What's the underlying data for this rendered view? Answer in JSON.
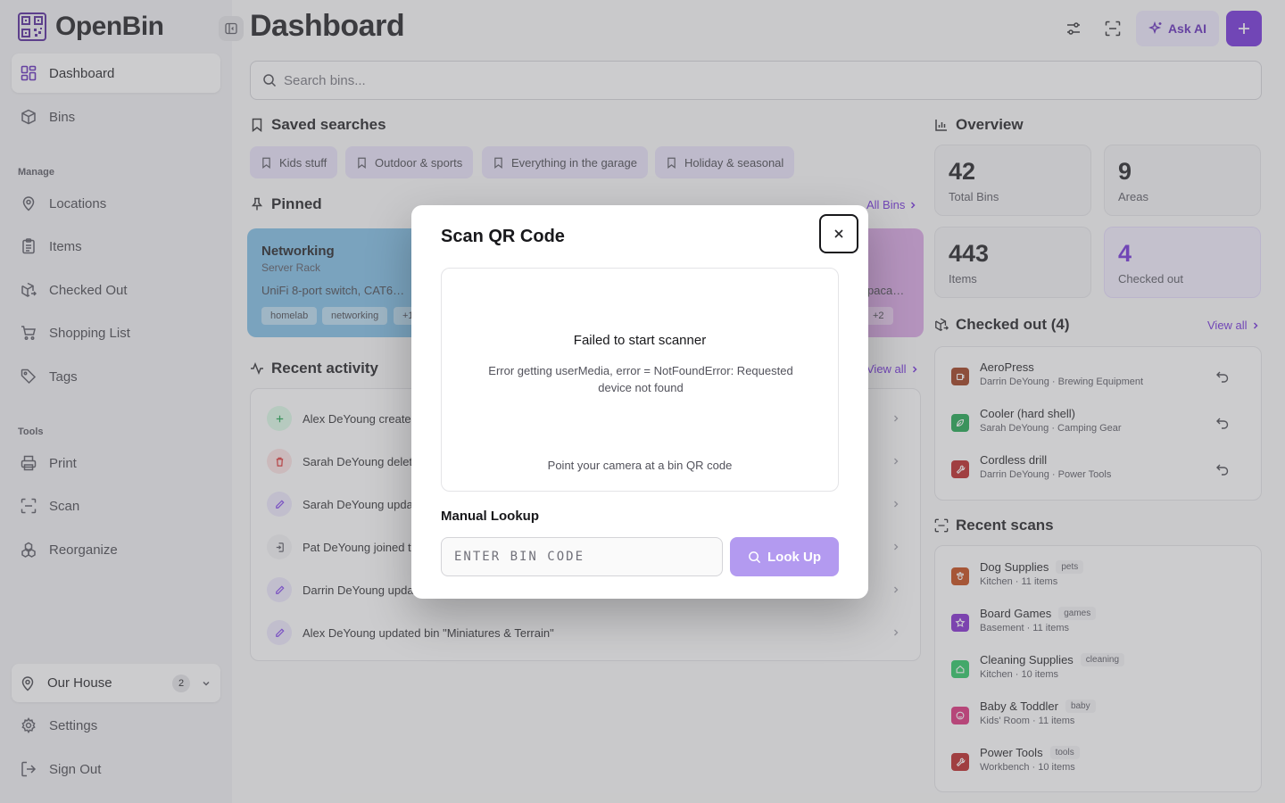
{
  "app": {
    "name": "OpenBin"
  },
  "sidebar": {
    "nav": [
      {
        "label": "Dashboard",
        "icon": "dashboard-icon",
        "active": true
      },
      {
        "label": "Bins",
        "icon": "box-icon"
      }
    ],
    "manage_heading": "Manage",
    "manage": [
      {
        "label": "Locations",
        "icon": "map-pin-icon"
      },
      {
        "label": "Items",
        "icon": "clipboard-list-icon"
      },
      {
        "label": "Checked Out",
        "icon": "package-out-icon"
      },
      {
        "label": "Shopping List",
        "icon": "shopping-cart-icon"
      },
      {
        "label": "Tags",
        "icon": "tag-icon"
      }
    ],
    "tools_heading": "Tools",
    "tools": [
      {
        "label": "Print",
        "icon": "printer-icon"
      },
      {
        "label": "Scan",
        "icon": "scan-icon"
      },
      {
        "label": "Reorganize",
        "icon": "reorganize-icon"
      }
    ],
    "location": {
      "label": "Our House",
      "count": "2"
    },
    "settings_label": "Settings",
    "signout_label": "Sign Out"
  },
  "header": {
    "title": "Dashboard",
    "ask_ai_label": "Ask AI"
  },
  "search": {
    "placeholder": "Search bins..."
  },
  "saved_searches": {
    "title": "Saved searches",
    "chips": [
      "Kids stuff",
      "Outdoor & sports",
      "Everything in the garage",
      "Holiday & seasonal"
    ]
  },
  "pinned": {
    "title": "Pinned",
    "all_bins_label": "All Bins",
    "cards": [
      {
        "name": "Networking",
        "area": "Server Rack",
        "desc": "UniFi 8-port switch, CAT6…",
        "tags": [
          "homelab",
          "networking",
          "+1"
        ],
        "color": "#3b9fd8"
      },
      {
        "name": "",
        "area": "",
        "desc": "paca…",
        "tags": [
          "+2"
        ],
        "color": "#c26ad8"
      }
    ]
  },
  "recent_activity": {
    "title": "Recent activity",
    "view_all_label": "View all",
    "rows": [
      {
        "text": "Alex DeYoung create",
        "kind": "create",
        "color": "#16a34a",
        "bg": "#dcfce7"
      },
      {
        "text": "Sarah DeYoung delet",
        "kind": "delete",
        "color": "#dc2626",
        "bg": "#fee2e2"
      },
      {
        "text": "Sarah DeYoung upda",
        "kind": "update",
        "color": "#7c3aed",
        "bg": "#ede9fe"
      },
      {
        "text": "Pat DeYoung joined t",
        "kind": "join",
        "color": "#52525b",
        "bg": "#f4f4f5"
      },
      {
        "text": "Darrin DeYoung upda",
        "kind": "update",
        "color": "#7c3aed",
        "bg": "#ede9fe"
      },
      {
        "text": "Alex DeYoung updated bin \"Miniatures & Terrain\"",
        "kind": "update",
        "color": "#7c3aed",
        "bg": "#ede9fe"
      }
    ]
  },
  "overview": {
    "title": "Overview",
    "stats": [
      {
        "value": "42",
        "label": "Total Bins"
      },
      {
        "value": "9",
        "label": "Areas"
      },
      {
        "value": "443",
        "label": "Items"
      },
      {
        "value": "4",
        "label": "Checked out",
        "accent": "#6d28d9"
      }
    ]
  },
  "checked_out": {
    "title": "Checked out (4)",
    "view_all_label": "View all",
    "rows": [
      {
        "name": "AeroPress",
        "meta": "Darrin DeYoung · Brewing Equipment",
        "color": "#9a3412",
        "icon": "coffee-icon"
      },
      {
        "name": "Cooler (hard shell)",
        "meta": "Sarah DeYoung · Camping Gear",
        "color": "#16a34a",
        "icon": "leaf-icon"
      },
      {
        "name": "Cordless drill",
        "meta": "Darrin DeYoung · Power Tools",
        "color": "#b91c1c",
        "icon": "wrench-icon"
      }
    ]
  },
  "recent_scans": {
    "title": "Recent scans",
    "rows": [
      {
        "name": "Dog Supplies",
        "tag": "pets",
        "meta": "Kitchen · 11 items",
        "color": "#c2410c",
        "icon": "paw-icon"
      },
      {
        "name": "Board Games",
        "tag": "games",
        "meta": "Basement · 11 items",
        "color": "#7e22ce",
        "icon": "star-icon"
      },
      {
        "name": "Cleaning Supplies",
        "tag": "cleaning",
        "meta": "Kitchen · 10 items",
        "color": "#22c55e",
        "icon": "home-icon"
      },
      {
        "name": "Baby & Toddler",
        "tag": "baby",
        "meta": "Kids' Room · 11 items",
        "color": "#db2777",
        "icon": "smile-icon"
      },
      {
        "name": "Power Tools",
        "tag": "tools",
        "meta": "Workbench · 10 items",
        "color": "#b91c1c",
        "icon": "wrench-icon"
      }
    ]
  },
  "modal": {
    "title": "Scan QR Code",
    "error_title": "Failed to start scanner",
    "error_message": "Error getting userMedia, error = NotFoundError: Requested device not found",
    "hint": "Point your camera at a bin QR code",
    "manual_label": "Manual Lookup",
    "input_placeholder": "ENTER BIN CODE",
    "lookup_label": "Look Up"
  }
}
